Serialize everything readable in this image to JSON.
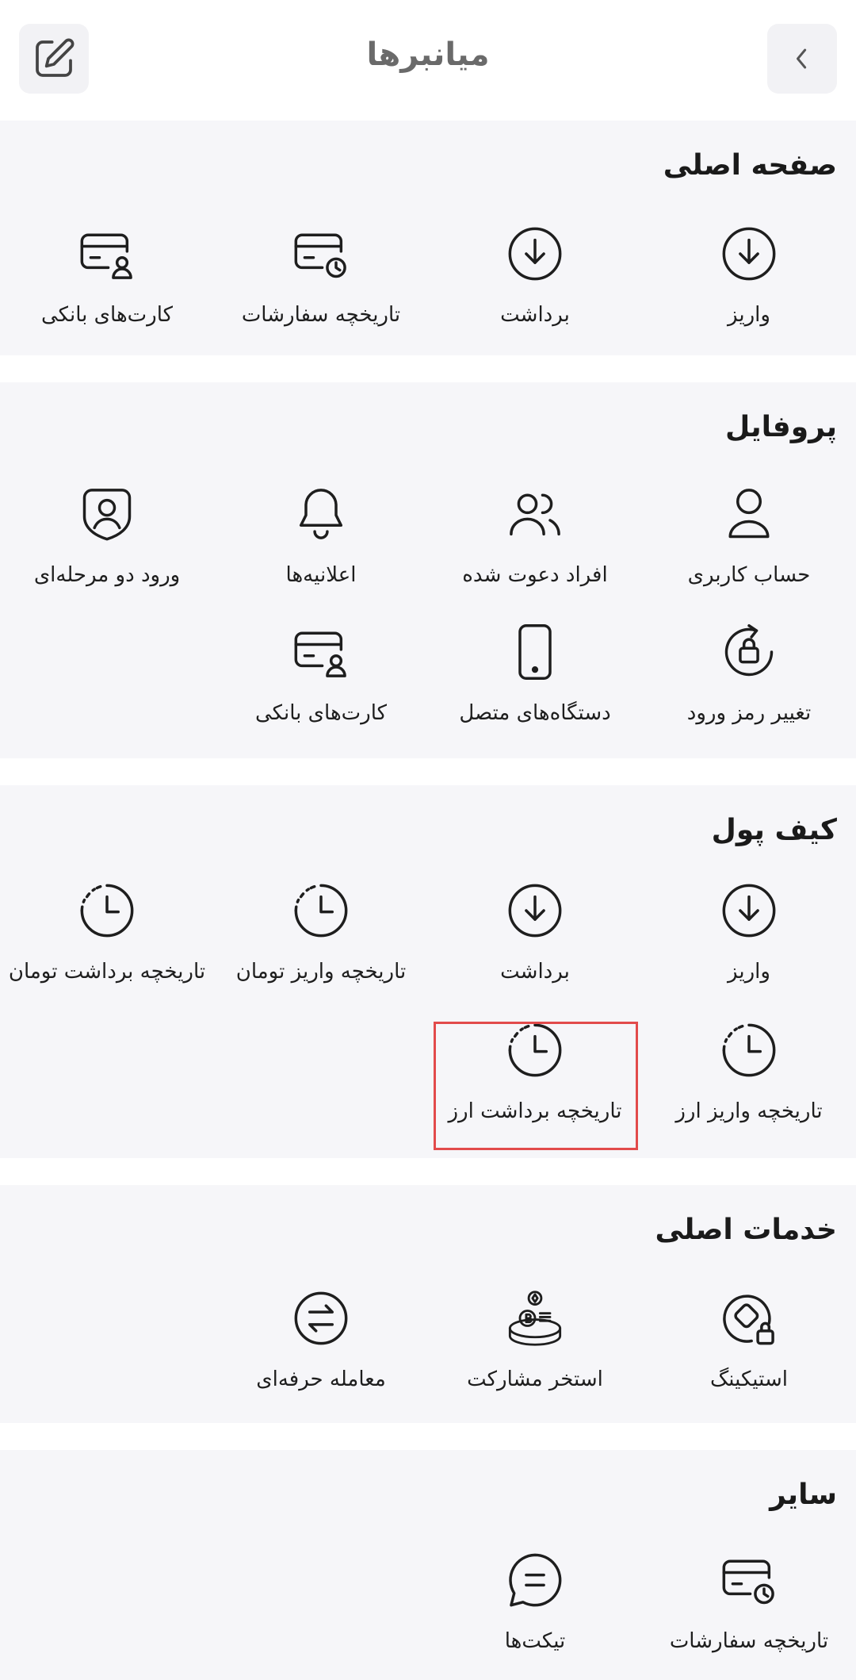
{
  "header": {
    "title": "میانبرها"
  },
  "sections": [
    {
      "title": "صفحه اصلی",
      "items": [
        {
          "label": "واریز",
          "icon": "deposit-icon"
        },
        {
          "label": "برداشت",
          "icon": "withdraw-icon"
        },
        {
          "label": "تاریخچه سفارشات",
          "icon": "card-clock-icon"
        },
        {
          "label": "کارت‌های بانکی",
          "icon": "bank-card-icon"
        }
      ]
    },
    {
      "title": "پروفایل",
      "items": [
        {
          "label": "حساب کاربری",
          "icon": "user-icon"
        },
        {
          "label": "افراد دعوت شده",
          "icon": "users-icon"
        },
        {
          "label": "اعلانیه‌ها",
          "icon": "bell-icon"
        },
        {
          "label": "ورود دو مرحله‌ای",
          "icon": "shield-user-icon"
        },
        {
          "label": "تغییر رمز ورود",
          "icon": "lock-reset-icon"
        },
        {
          "label": "دستگاه‌های متصل",
          "icon": "phone-icon"
        },
        {
          "label": "کارت‌های بانکی",
          "icon": "bank-card-icon"
        }
      ]
    },
    {
      "title": "کیف پول",
      "items": [
        {
          "label": "واریز",
          "icon": "deposit-icon"
        },
        {
          "label": "برداشت",
          "icon": "withdraw-icon"
        },
        {
          "label": "تاریخچه واریز تومان",
          "icon": "history-icon"
        },
        {
          "label": "تاریخچه برداشت تومان",
          "icon": "history-icon"
        },
        {
          "label": "تاریخچه واریز ارز",
          "icon": "history-icon"
        },
        {
          "label": "تاریخچه برداشت ارز",
          "icon": "history-icon"
        }
      ]
    },
    {
      "title": "خدمات اصلی",
      "items": [
        {
          "label": "استیکینگ",
          "icon": "staking-icon"
        },
        {
          "label": "استخر مشارکت",
          "icon": "liquidity-pool-icon"
        },
        {
          "label": "معامله حرفه‌ای",
          "icon": "exchange-icon"
        }
      ]
    },
    {
      "title": "سایر",
      "items": [
        {
          "label": "تاریخچه سفارشات",
          "icon": "card-clock-icon"
        },
        {
          "label": "تیکت‌ها",
          "icon": "chat-icon"
        }
      ]
    }
  ],
  "colors": {
    "background": "#f6f6f9",
    "highlight": "#e24b4b",
    "text": "#1e1e1e"
  }
}
